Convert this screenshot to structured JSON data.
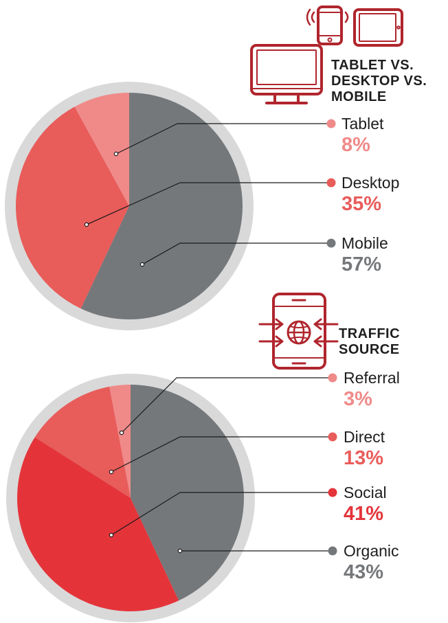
{
  "colors": {
    "ring": "#d9d9d9",
    "icon": "#b0252d",
    "gray": "#75787b",
    "pink": "#ef8a89",
    "salmon": "#e85c5a",
    "red": "#e4343a",
    "leader": "#1a1a1a"
  },
  "chart_data": [
    {
      "type": "pie",
      "title": [
        "TABLET VS.",
        "DESKTOP VS.",
        "MOBILE"
      ],
      "icon": "devices-icon",
      "slices": [
        {
          "label": "Tablet",
          "value": 8,
          "display": "8%",
          "color": "#ef8a89"
        },
        {
          "label": "Desktop",
          "value": 35,
          "display": "35%",
          "color": "#e85c5a"
        },
        {
          "label": "Mobile",
          "value": 57,
          "display": "57%",
          "color": "#75787b"
        }
      ]
    },
    {
      "type": "pie",
      "title": [
        "TRAFFIC",
        "SOURCE"
      ],
      "icon": "traffic-phone-globe-icon",
      "slices": [
        {
          "label": "Referral",
          "value": 3,
          "display": "3%",
          "color": "#ef8a89"
        },
        {
          "label": "Direct",
          "value": 13,
          "display": "13%",
          "color": "#e85c5a"
        },
        {
          "label": "Social",
          "value": 41,
          "display": "41%",
          "color": "#e4343a"
        },
        {
          "label": "Organic",
          "value": 43,
          "display": "43%",
          "color": "#75787b"
        }
      ]
    }
  ]
}
